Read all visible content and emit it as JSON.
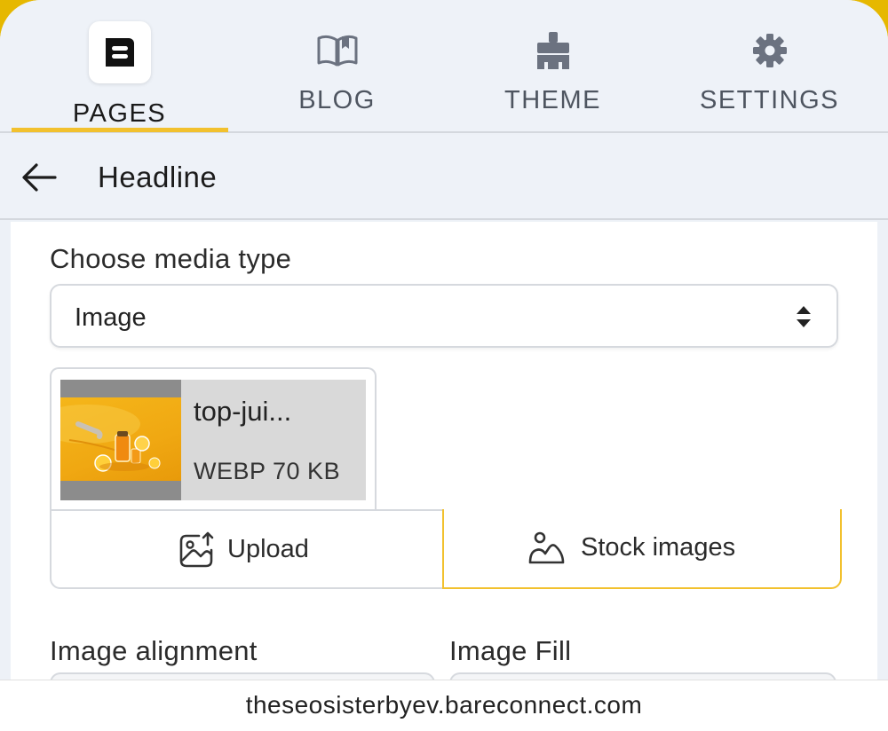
{
  "tabs": [
    {
      "label": "PAGES",
      "icon": "pages-icon",
      "active": true
    },
    {
      "label": "BLOG",
      "icon": "book-icon",
      "active": false
    },
    {
      "label": "THEME",
      "icon": "paint-brush-icon",
      "active": false
    },
    {
      "label": "SETTINGS",
      "icon": "gear-icon",
      "active": false
    }
  ],
  "header": {
    "title": "Headline",
    "back_icon": "arrow-left-icon"
  },
  "media": {
    "label": "Choose media type",
    "type_value": "Image",
    "file": {
      "name": "top-jui...",
      "meta": "WEBP 70 KB"
    }
  },
  "buttons": {
    "upload": "Upload",
    "stock": "Stock images"
  },
  "fields": {
    "alignment_label": "Image alignment",
    "fill_label": "Image Fill"
  },
  "url": "theseosisterbyev.bareconnect.com",
  "colors": {
    "accent": "#f2c12e",
    "background": "#eef2f8"
  }
}
